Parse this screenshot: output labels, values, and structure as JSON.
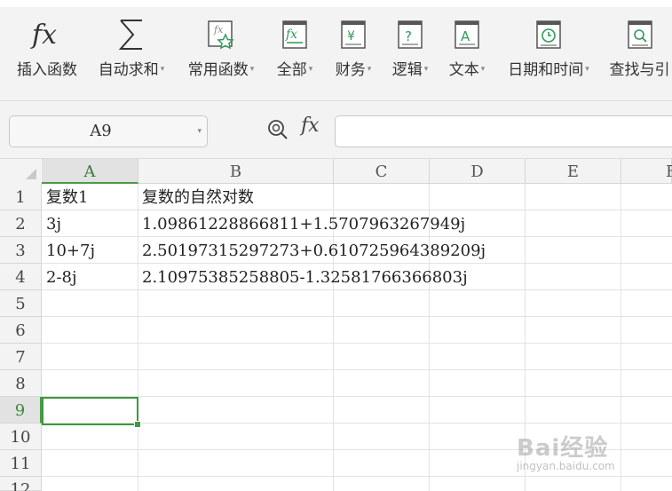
{
  "ribbon": {
    "items": [
      {
        "label": "插入函数",
        "icon": "fx-icon",
        "caret": ""
      },
      {
        "label": "自动求和",
        "icon": "sigma-icon",
        "caret": "▾"
      },
      {
        "label": "常用函数",
        "icon": "star-function-icon",
        "caret": "▾"
      },
      {
        "label": "全部",
        "icon": "all-functions-icon",
        "caret": "▾"
      },
      {
        "label": "财务",
        "icon": "finance-icon",
        "caret": "▾"
      },
      {
        "label": "逻辑",
        "icon": "logic-icon",
        "caret": "▾"
      },
      {
        "label": "文本",
        "icon": "text-icon",
        "caret": "▾"
      },
      {
        "label": "日期和时间",
        "icon": "datetime-icon",
        "caret": "▾"
      },
      {
        "label": "查找与引",
        "icon": "lookup-icon",
        "caret": ""
      }
    ]
  },
  "formula_bar": {
    "name_box": "A9",
    "fx_label": "fx",
    "formula": ""
  },
  "grid": {
    "columns": [
      "A",
      "B",
      "C",
      "D",
      "E",
      "F"
    ],
    "selected_column": "A",
    "rows": [
      "1",
      "2",
      "3",
      "4",
      "5",
      "6",
      "7",
      "8",
      "9",
      "10",
      "11",
      "12"
    ],
    "selected_row": "9",
    "cells": {
      "A1": "复数1",
      "B1": "复数的自然对数",
      "A2": "3j",
      "B2": "1.09861228866811+1.5707963267949j",
      "A3": "10+7j",
      "B3": "2.50197315297273+0.610725964389209j",
      "A4": "2-8j",
      "B4": "2.10975385258805-1.32581766366803j"
    }
  },
  "watermark": {
    "brand": "Bai经验",
    "url": "jingyan.baidu.com"
  },
  "colors": {
    "accent_green": "#3b9a3b",
    "ribbon_bg": "#f3f3f3"
  }
}
